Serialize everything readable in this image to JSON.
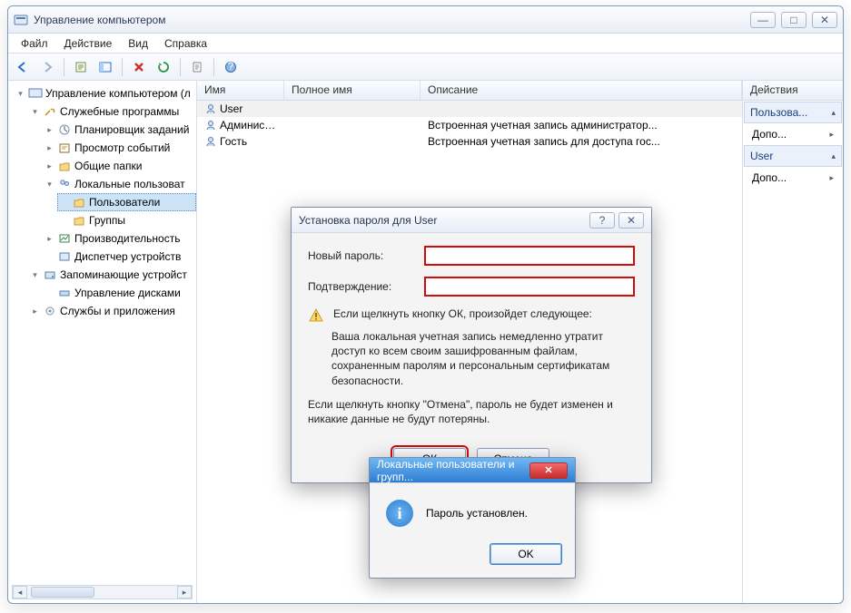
{
  "window": {
    "title": "Управление компьютером",
    "min_label": "—",
    "max_label": "□",
    "close_label": "✕"
  },
  "menu": {
    "items": [
      "Файл",
      "Действие",
      "Вид",
      "Справка"
    ]
  },
  "tree": {
    "root": "Управление компьютером (л",
    "sys": "Служебные программы",
    "task": "Планировщик заданий",
    "event": "Просмотр событий",
    "shared": "Общие папки",
    "lusers": "Локальные пользоват",
    "users": "Пользователи",
    "groups": "Группы",
    "perf": "Производительность",
    "devmgr": "Диспетчер устройств",
    "storage": "Запоминающие устройст",
    "diskmgr": "Управление дисками",
    "svcs": "Службы и приложения"
  },
  "list": {
    "headers": [
      "Имя",
      "Полное имя",
      "Описание"
    ],
    "rows": [
      {
        "name": "User",
        "full": "",
        "desc": ""
      },
      {
        "name": "Администр...",
        "full": "",
        "desc": "Встроенная учетная запись администратор..."
      },
      {
        "name": "Гость",
        "full": "",
        "desc": "Встроенная учетная запись для доступа гос..."
      }
    ]
  },
  "actions": {
    "header": "Действия",
    "group1": "Пользова...",
    "item1": "Допо...",
    "group2": "User",
    "item2": "Допо..."
  },
  "dlg1": {
    "title": "Установка пароля для User",
    "help_label": "?",
    "close_label": "✕",
    "new_pw": "Новый пароль:",
    "confirm": "Подтверждение:",
    "warn": "Если щелкнуть кнопку ОК, произойдет следующее:",
    "note": "Ваша локальная учетная запись немедленно утратит доступ ко всем своим зашифрованным файлам, сохраненным паролям и персональным сертификатам безопасности.",
    "note2": "Если щелкнуть кнопку \"Отмена\", пароль не будет изменен и никакие данные не будут потеряны.",
    "ok": "ОК",
    "cancel": "Отмена"
  },
  "dlg2": {
    "title": "Локальные пользователи и групп...",
    "msg": "Пароль установлен.",
    "ok": "OK"
  }
}
